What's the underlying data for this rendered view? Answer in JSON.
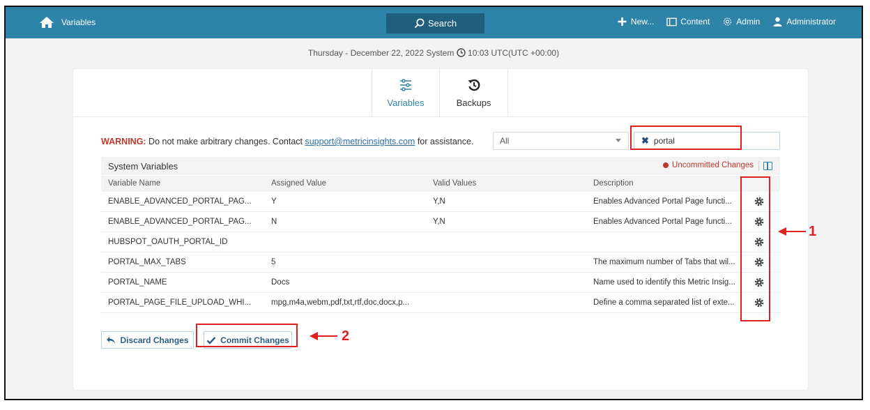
{
  "topbar": {
    "title": "Variables",
    "search_label": "Search",
    "nav": [
      {
        "label": "New...",
        "icon": "plus-icon"
      },
      {
        "label": "Content",
        "icon": "folder-icon"
      },
      {
        "label": "Admin",
        "icon": "gear-icon"
      },
      {
        "label": "Administrator",
        "icon": "user-icon"
      }
    ]
  },
  "datetime": {
    "prefix": "Thursday - December 22, 2022 System",
    "suffix": "10:03 UTC(UTC +00:00)"
  },
  "tabs": [
    {
      "label": "Variables",
      "active": true,
      "icon": "sliders-icon"
    },
    {
      "label": "Backups",
      "active": false,
      "icon": "history-icon"
    }
  ],
  "warning": {
    "label": "WARNING:",
    "text_before": " Do not make arbitrary changes. Contact ",
    "link": "support@metricinsights.com",
    "text_after": " for assistance."
  },
  "filter": {
    "selected": "All"
  },
  "search": {
    "value": "portal"
  },
  "table": {
    "title": "System Variables",
    "uncommitted": "Uncommitted Changes",
    "columns": [
      "Variable Name",
      "Assigned Value",
      "Valid Values",
      "Description"
    ],
    "rows": [
      [
        "ENABLE_ADVANCED_PORTAL_PAG...",
        "Y",
        "Y,N",
        "Enables Advanced Portal Page functi..."
      ],
      [
        "ENABLE_ADVANCED_PORTAL_PAG...",
        "N",
        "Y,N",
        "Enables Advanced Portal Page functi..."
      ],
      [
        "HUBSPOT_OAUTH_PORTAL_ID",
        "",
        "",
        ""
      ],
      [
        "PORTAL_MAX_TABS",
        "5",
        "",
        "The maximum number of Tabs that wil..."
      ],
      [
        "PORTAL_NAME",
        "Docs",
        "",
        "Name used to identify this Metric Insig..."
      ],
      [
        "PORTAL_PAGE_FILE_UPLOAD_WHI...",
        "mpg,m4a,webm,pdf,txt,rtf,doc,docx,p...",
        "",
        "Define a comma separated list of exte..."
      ]
    ]
  },
  "buttons": {
    "discard": "Discard Changes",
    "commit": "Commit Changes"
  },
  "annotations": {
    "one": "1",
    "two": "2",
    "color": "#e02020"
  }
}
